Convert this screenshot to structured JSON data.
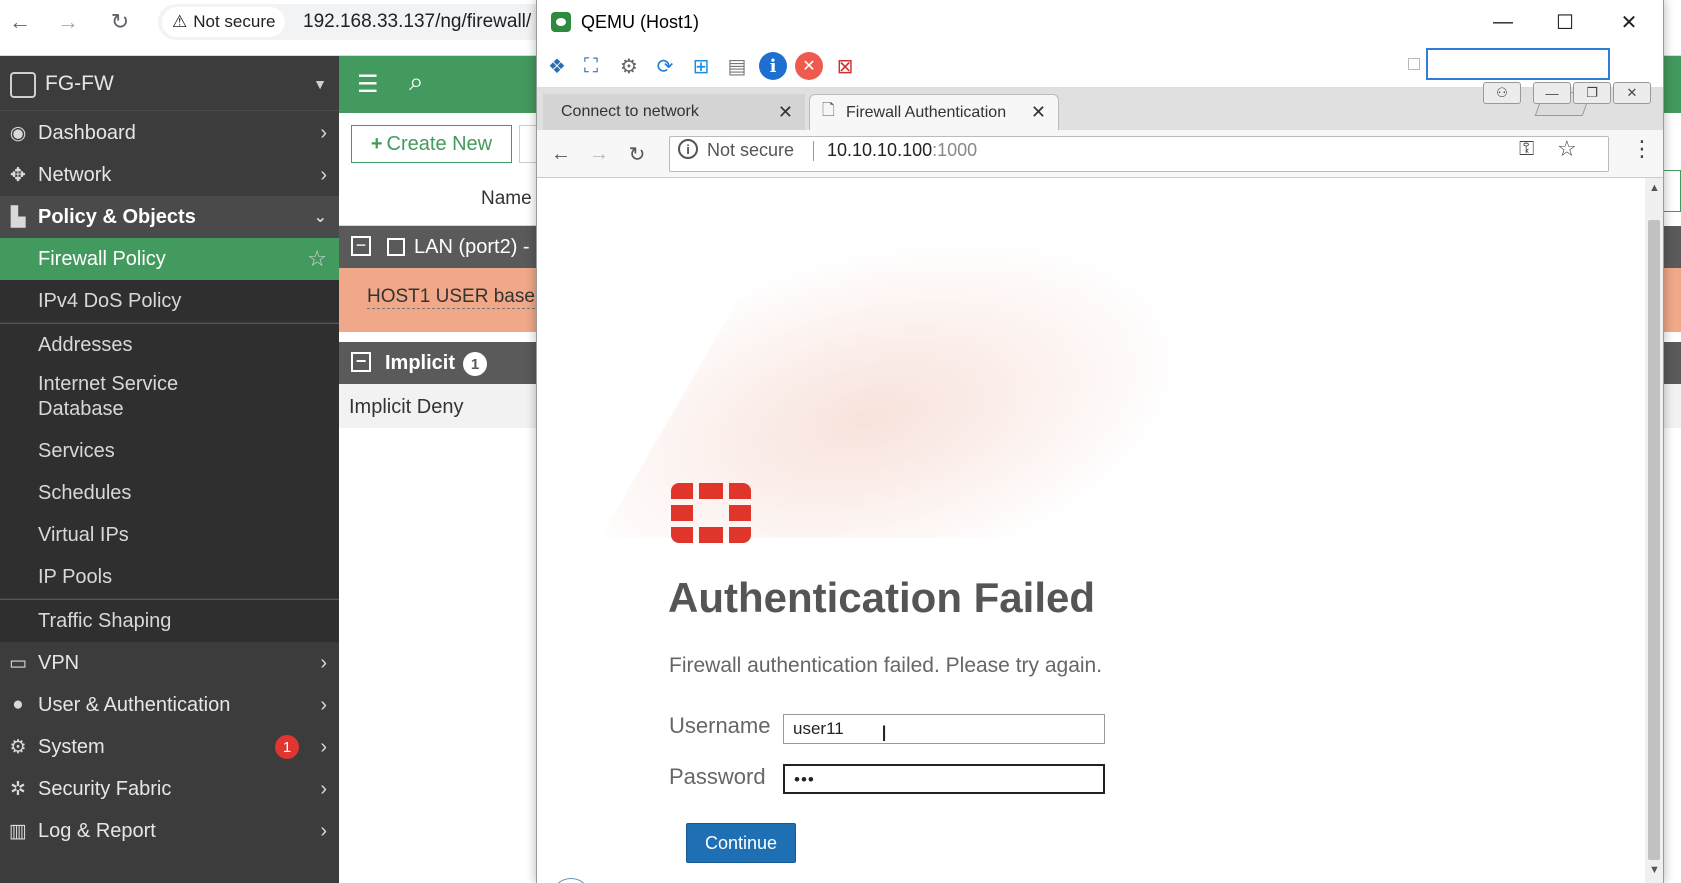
{
  "host": {
    "not_secure": "Not secure",
    "url": "192.168.33.137/ng/firewall/"
  },
  "fortigate": {
    "device": "FG-FW",
    "menu": [
      {
        "label": "Dashboard"
      },
      {
        "label": "Network"
      },
      {
        "label": "Policy & Objects"
      },
      {
        "label": "Firewall Policy"
      },
      {
        "label": "IPv4 DoS Policy"
      },
      {
        "label": "Addresses"
      },
      {
        "label": "Internet Service Database"
      },
      {
        "label": "Services"
      },
      {
        "label": "Schedules"
      },
      {
        "label": "Virtual IPs"
      },
      {
        "label": "IP Pools"
      },
      {
        "label": "Traffic Shaping"
      },
      {
        "label": "VPN"
      },
      {
        "label": "User & Authentication"
      },
      {
        "label": "System",
        "badge": "1"
      },
      {
        "label": "Security Fabric"
      },
      {
        "label": "Log & Report"
      }
    ],
    "create_new": "Create New",
    "column_name": "Name",
    "group_lan": "LAN (port2) -",
    "row_host": "HOST1 USER base",
    "group_implicit": "Implicit",
    "group_implicit_count": "1",
    "row_deny": "Implicit Deny",
    "accent": "#439a5e"
  },
  "qemu": {
    "title": "QEMU (Host1)",
    "tabs": [
      {
        "label": "Connect to network"
      },
      {
        "label": "Firewall Authentication"
      }
    ],
    "not_secure": "Not secure",
    "url_host": "10.10.10.100",
    "url_port": ":1000",
    "page": {
      "heading": "Authentication Failed",
      "message": "Firewall authentication failed. Please try again.",
      "username_label": "Username",
      "username_value": "user11",
      "password_label": "Password",
      "password_value": "•••",
      "continue": "Continue",
      "accent": "#1f6fb5",
      "logo_color": "#e0352b"
    }
  }
}
